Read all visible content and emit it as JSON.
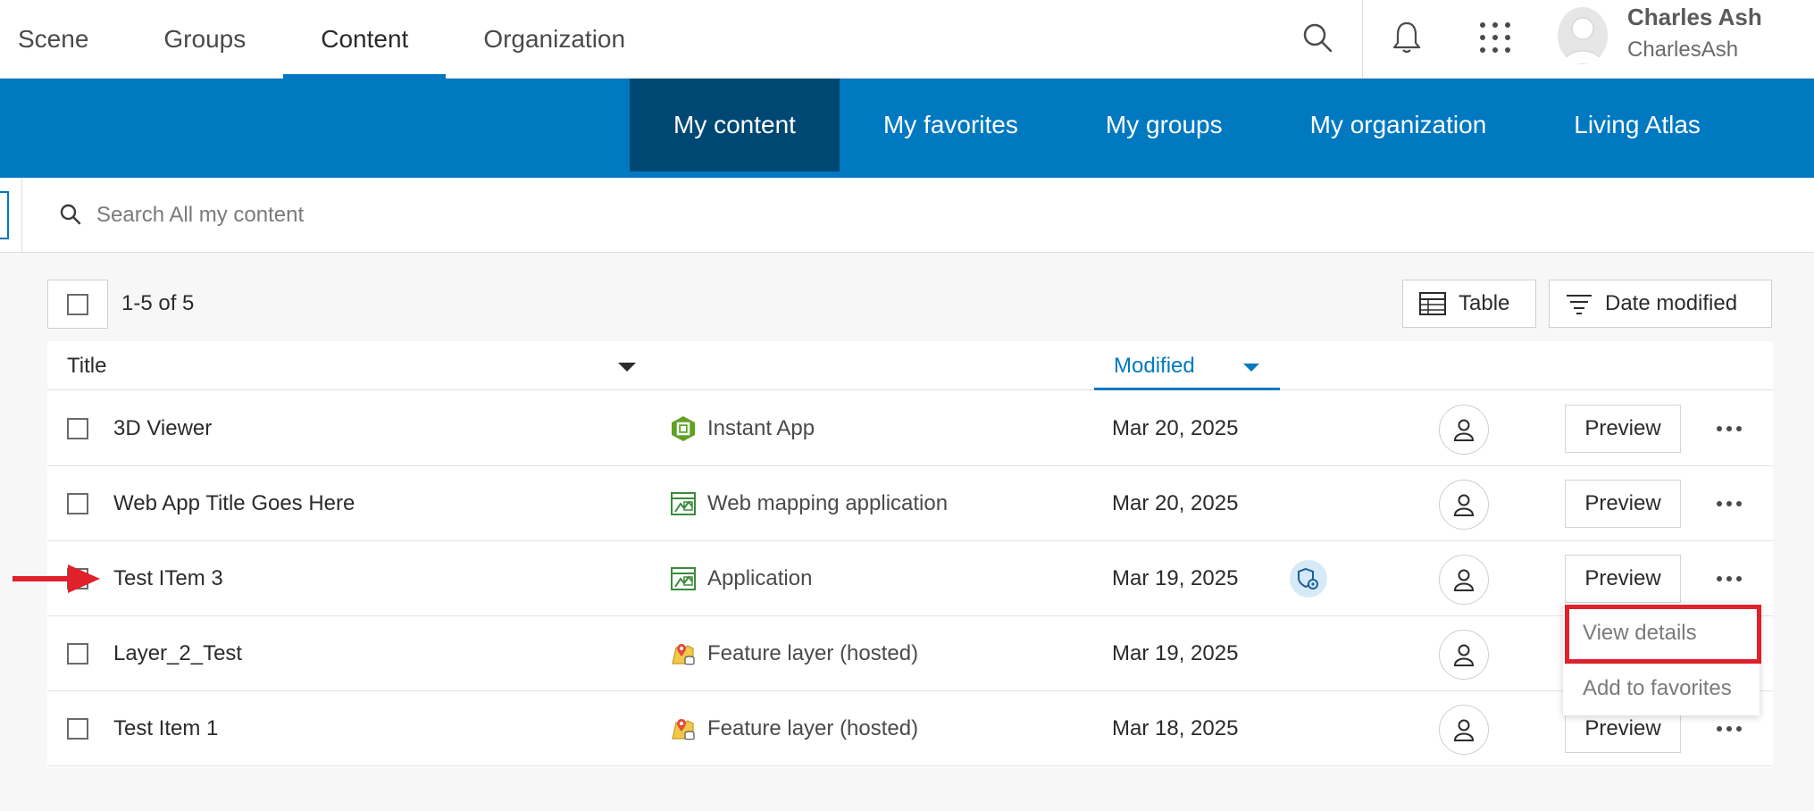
{
  "top_nav": {
    "items": [
      {
        "label": "Scene",
        "active": false
      },
      {
        "label": "Groups",
        "active": false
      },
      {
        "label": "Content",
        "active": true
      },
      {
        "label": "Organization",
        "active": false
      }
    ]
  },
  "header_icons": [
    "search-icon",
    "bell-icon",
    "app-launcher-icon"
  ],
  "user": {
    "name": "Charles Ash",
    "username": "CharlesAsh"
  },
  "content_tabs": [
    {
      "label": "My content",
      "active": true
    },
    {
      "label": "My favorites",
      "active": false
    },
    {
      "label": "My groups",
      "active": false
    },
    {
      "label": "My organization",
      "active": false
    },
    {
      "label": "Living Atlas",
      "active": false
    }
  ],
  "search": {
    "placeholder": "Search All my content",
    "value": ""
  },
  "toolbar": {
    "count": "1-5 of 5",
    "view_label": "Table",
    "sort_label": "Date modified"
  },
  "table": {
    "columns": {
      "title": "Title",
      "modified": "Modified"
    },
    "rows": [
      {
        "title": "3D Viewer",
        "type": "Instant App",
        "type_icon": "instant-app-icon",
        "modified": "Mar 20, 2025",
        "status_icon": null,
        "preview": "Preview"
      },
      {
        "title": "Web App Title Goes Here",
        "type": "Web mapping application",
        "type_icon": "web-mapping-app-icon",
        "modified": "Mar 20, 2025",
        "status_icon": null,
        "preview": "Preview"
      },
      {
        "title": "Test ITem 3",
        "type": "Application",
        "type_icon": "web-mapping-app-icon",
        "modified": "Mar 19, 2025",
        "status_icon": "settings-shield-icon",
        "preview": "Preview"
      },
      {
        "title": "Layer_2_Test",
        "type": "Feature layer (hosted)",
        "type_icon": "feature-layer-icon",
        "modified": "Mar 19, 2025",
        "status_icon": null,
        "preview": "Preview"
      },
      {
        "title": "Test Item 1",
        "type": "Feature layer (hosted)",
        "type_icon": "feature-layer-icon",
        "modified": "Mar 18, 2025",
        "status_icon": null,
        "preview": "Preview"
      }
    ]
  },
  "dropdown": {
    "items": [
      {
        "label": "View details",
        "highlighted": true
      },
      {
        "label": "Add to favorites",
        "highlighted": false
      }
    ]
  },
  "colors": {
    "brand_blue": "#0079c1",
    "active_tab": "#004874",
    "highlight_red": "#e0202a",
    "instant_app_green": "#5fa223"
  }
}
